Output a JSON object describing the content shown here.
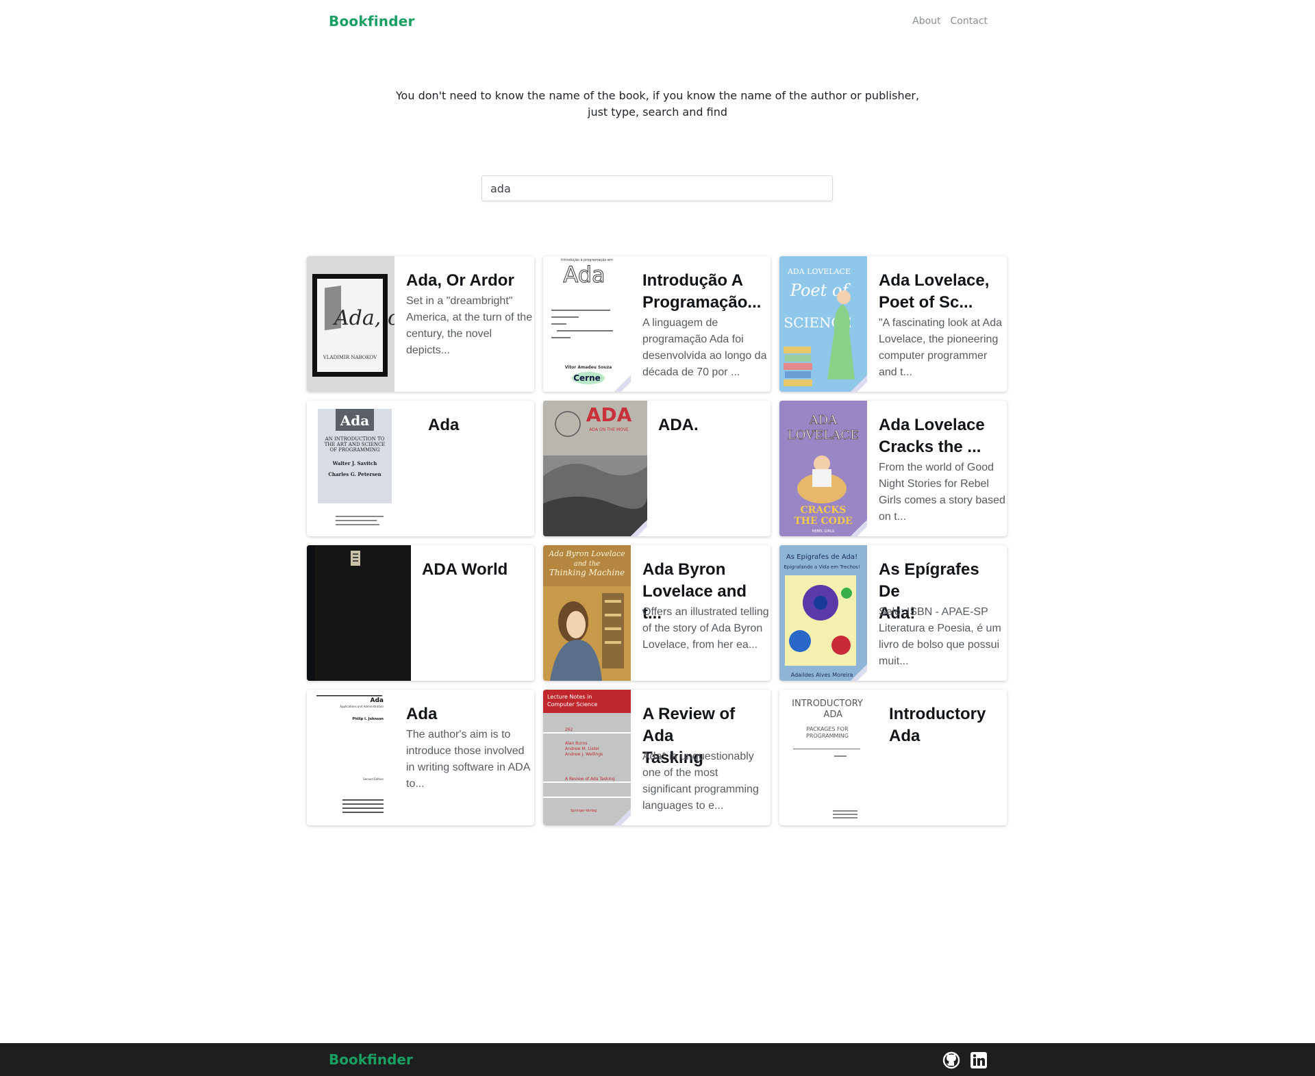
{
  "header": {
    "logo": "Bookfinder",
    "nav": [
      "About",
      "Contact"
    ]
  },
  "tagline": {
    "line1": "You don't need to know the name of the book, if you know the name of the author or publisher,",
    "line2": "just type, search and find"
  },
  "search": {
    "value": "ada"
  },
  "books": [
    {
      "title": "Ada, Or Ardor",
      "title2": "",
      "desc": [
        "Set in a \"dreambright\"",
        "America, at the turn of the",
        "century, the novel",
        "depicts..."
      ],
      "cover_text": [
        "VLADIMIR NABOKOV",
        "Ada, or"
      ]
    },
    {
      "title": "Introdução A",
      "title2": "Programação...",
      "desc": [
        "A linguagem de",
        "programação Ada foi",
        "desenvolvida ao longo da",
        "década de 70 por ..."
      ],
      "cover_text": [
        "Introdução à programação em",
        "Ada",
        "Vitor Amadeu Souza",
        "Cerne"
      ]
    },
    {
      "title": "Ada Lovelace,",
      "title2": "Poet of Sc...",
      "desc": [
        "\"A fascinating look at Ada",
        "Lovelace, the pioneering",
        "computer programmer",
        "and t..."
      ],
      "cover_text": [
        "ADA LOVELACE",
        "Poet of",
        "SCIENCE"
      ]
    },
    {
      "title": "Ada",
      "title2": "",
      "desc": [],
      "cover_text": [
        "Ada",
        "AN INTRODUCTION TO",
        "THE ART AND SCIENCE",
        "OF PROGRAMMING",
        "Walter J. Savitch",
        "Charles G. Petersen"
      ]
    },
    {
      "title": "ADA.",
      "title2": "",
      "desc": [],
      "cover_text": [
        "ADA",
        "ADA ON THE MOVE"
      ]
    },
    {
      "title": "Ada Lovelace",
      "title2": "Cracks the ...",
      "desc": [
        "From the world of Good",
        "Night Stories for Rebel",
        "Girls comes a story based",
        "on t..."
      ],
      "cover_text": [
        "ADA",
        "LOVELACE",
        "CRACKS",
        "THE CODE",
        "REBEL GIRLS"
      ]
    },
    {
      "title": "ADA World",
      "title2": "",
      "desc": [],
      "cover_text": []
    },
    {
      "title": "Ada Byron",
      "title2": "Lovelace and t...",
      "desc": [
        "Offers an illustrated telling",
        "of the story of Ada Byron",
        "Lovelace, from her ea..."
      ],
      "cover_text": [
        "Ada Byron Lovelace",
        "and the",
        "Thinking Machine"
      ]
    },
    {
      "title": "As Epígrafes De",
      "title2": "Ada!",
      "desc": [
        "Selo: ISBN - APAE-SP",
        "Literatura e Poesia, é um",
        "livro de bolso que possui",
        "muit..."
      ],
      "cover_text": [
        "As Epígrafes de Ada!",
        "Epigrafando a Vida em Trechos!",
        "Adaildes Alves Moreira"
      ]
    },
    {
      "title": "Ada",
      "title2": "",
      "desc": [
        "The author's aim is to",
        "introduce those involved",
        "in writing software in ADA",
        "to..."
      ],
      "cover_text": [
        "Ada",
        "Applications and Administration",
        "Philip I. Johnson",
        "Second Edition"
      ]
    },
    {
      "title": "A Review of Ada",
      "title2": "Tasking",
      "desc": [
        "Ada* is unquestionably",
        "one of the most",
        "significant programming",
        "languages to e..."
      ],
      "cover_text": [
        "Lecture Notes in",
        "Computer Science",
        "262",
        "Alan Burns",
        "Andrew M. Lister",
        "Andrew J. Wellings",
        "A Review of Ada Tasking",
        "Springer-Verlag"
      ]
    },
    {
      "title": "Introductory",
      "title2": "Ada",
      "desc": [],
      "cover_text": [
        "INTRODUCTORY",
        "ADA",
        "PACKAGES FOR",
        "PROGRAMMING"
      ]
    }
  ],
  "footer": {
    "logo": "Bookfinder",
    "icons": [
      "github-icon",
      "linkedin-icon"
    ]
  }
}
